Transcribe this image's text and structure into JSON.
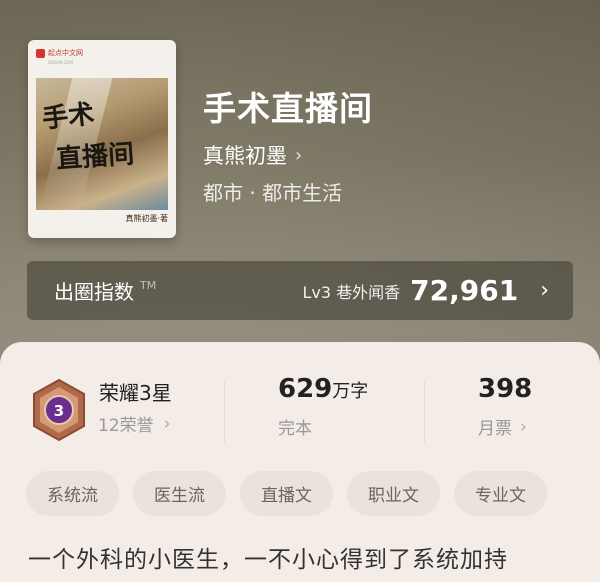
{
  "book": {
    "title": "手术直播间",
    "author": "真熊初墨",
    "genre": "都市 · 都市生活",
    "cover": {
      "publisher": "起点中文网",
      "publisher_sub": "QIDIAN.COM",
      "calligraphy_line1": "手术",
      "calligraphy_line2": "直播间",
      "signature": "真熊初墨·著"
    }
  },
  "index": {
    "label": "出圈指数",
    "trademark": "TM",
    "level_text": "Lv3 巷外闻香",
    "score": "72,961"
  },
  "stats": {
    "honor_title": "荣耀3星",
    "honor_count": "12荣誉",
    "badge_number": "3",
    "word_count": "629",
    "word_unit": "万字",
    "status": "完本",
    "monthly_tickets": "398",
    "monthly_tickets_label": "月票"
  },
  "tags": [
    "系统流",
    "医生流",
    "直播文",
    "职业文",
    "专业文"
  ],
  "description": "一个外科的小医生，一不小心得到了系统加持",
  "colors": {
    "card_bg": "#f4ece7",
    "tag_bg": "#ebe2dc",
    "badge_purple": "#6a2e8c",
    "badge_bronze": "#b06a4a"
  }
}
